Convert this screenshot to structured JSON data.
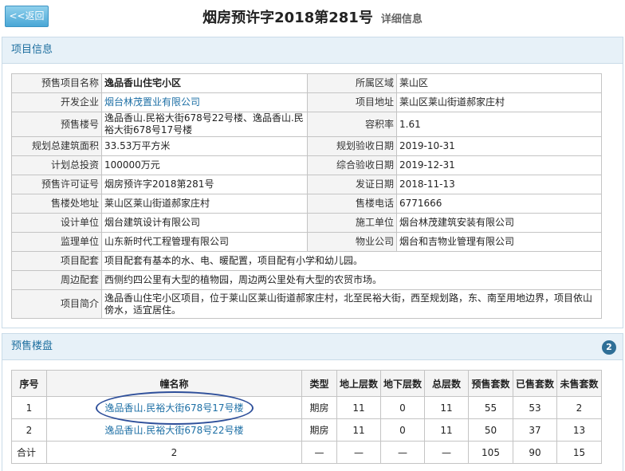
{
  "header": {
    "back_label": "<<返回",
    "title": "烟房预许字2018第281号",
    "subtitle": "详细信息"
  },
  "project_panel": {
    "title": "项目信息",
    "fields": {
      "name_label": "预售项目名称",
      "name": "逸品香山住宅小区",
      "district_label": "所属区域",
      "district": "莱山区",
      "developer_label": "开发企业",
      "developer": "烟台林茂置业有限公司",
      "address_label": "项目地址",
      "address": "莱山区莱山街道郝家庄村",
      "buildings_label": "预售楼号",
      "buildings": "逸品香山.民裕大街678号22号楼、逸品香山.民裕大街678号17号楼",
      "plot_ratio_label": "容积率",
      "plot_ratio": "1.61",
      "area_label": "规划总建筑面积",
      "area": "33.53万平方米",
      "plan_accept_label": "规划验收日期",
      "plan_accept": "2019-10-31",
      "investment_label": "计划总投资",
      "investment": "100000万元",
      "final_accept_label": "综合验收日期",
      "final_accept": "2019-12-31",
      "permit_label": "预售许可证号",
      "permit": "烟房预许字2018第281号",
      "issue_date_label": "发证日期",
      "issue_date": "2018-11-13",
      "sales_office_label": "售楼处地址",
      "sales_office": "莱山区莱山街道郝家庄村",
      "phone_label": "售楼电话",
      "phone": "6771666",
      "designer_label": "设计单位",
      "designer": "烟台建筑设计有限公司",
      "builder_label": "施工单位",
      "builder": "烟台林茂建筑安装有限公司",
      "supervisor_label": "监理单位",
      "supervisor": "山东新时代工程管理有限公司",
      "property_label": "物业公司",
      "property": "烟台和吉物业管理有限公司",
      "facilities_label": "项目配套",
      "facilities": "项目配套有基本的水、电、暖配置，项目配有小学和幼儿园。",
      "surroundings_label": "周边配套",
      "surroundings": "西侧约四公里有大型的植物园，周边两公里处有大型的农贸市场。",
      "intro_label": "项目简介",
      "intro": "逸品香山住宅小区项目，位于莱山区莱山街道郝家庄村，北至民裕大街，西至规划路，东、南至用地边界，项目依山傍水，适宜居住。"
    }
  },
  "sale_panel": {
    "title": "预售楼盘",
    "count": "2",
    "columns": [
      "序号",
      "幢名称",
      "类型",
      "地上层数",
      "地下层数",
      "总层数",
      "预售套数",
      "已售套数",
      "未售套数"
    ],
    "rows": [
      [
        "1",
        "逸品香山.民裕大街678号17号楼",
        "期房",
        "11",
        "0",
        "11",
        "55",
        "53",
        "2"
      ],
      [
        "2",
        "逸品香山.民裕大街678号22号楼",
        "期房",
        "11",
        "0",
        "11",
        "50",
        "37",
        "13"
      ]
    ],
    "total": [
      "合计",
      "2",
      "—",
      "—",
      "—",
      "—",
      "105",
      "90",
      "15"
    ]
  },
  "colors": {
    "accent": "#1d6fa5",
    "panel_header_bg": "#e7f1f8",
    "label_bg": "#f4f4f4",
    "button": "#4aa7d6",
    "annotation_circle": "#2e4f9a"
  }
}
